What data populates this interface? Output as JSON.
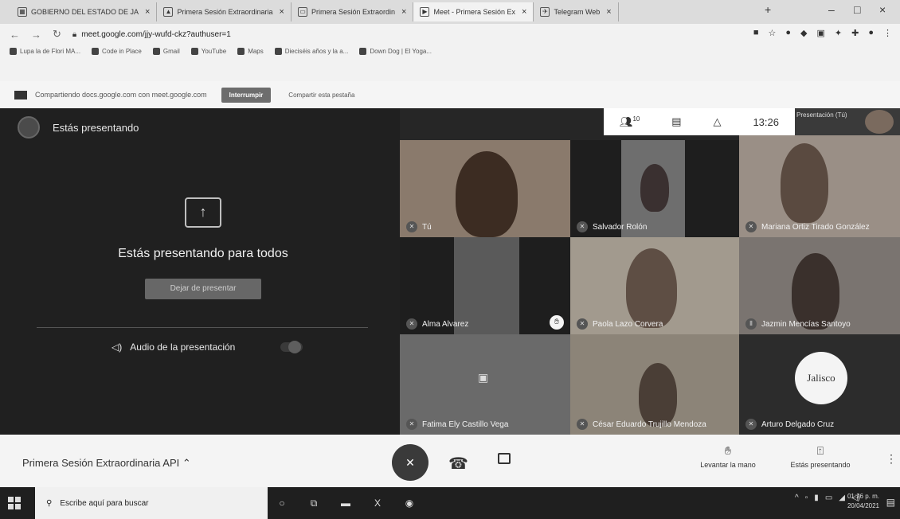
{
  "browser": {
    "tabs": [
      {
        "label": "GOBIERNO DEL ESTADO DE JA",
        "icon": "sheet-icon"
      },
      {
        "label": "Primera Sesión Extraordinaria",
        "icon": "drive-icon"
      },
      {
        "label": "Primera Sesión Extraordin",
        "icon": "slides-icon"
      },
      {
        "label": "Meet - Primera Sesión Ex",
        "icon": "meet-icon"
      },
      {
        "label": "Telegram Web",
        "icon": "telegram-icon"
      }
    ],
    "url": "meet.google.com/jjy-wufd-ckz?authuser=1",
    "bookmarks": [
      "Lupa la de Flori MA...",
      "Code in Place",
      "Gmail",
      "YouTube",
      "Maps",
      "Dieciséis años y la a...",
      "Down Dog | El Yoga..."
    ]
  },
  "share_banner": {
    "text": "Compartiendo docs.google.com con meet.google.com",
    "stop_label": "Interrumpir",
    "share_tab_label": "Compartir esta pestaña"
  },
  "meet": {
    "presenting_title": "Estás presentando",
    "presenting_all": "Estás presentando para todos",
    "stop_presenting": "Dejar de presentar",
    "audio_label": "Audio de la presentación",
    "participant_count": "10",
    "time": "13:26",
    "mini_label": "Presentación (Tú)",
    "participants": [
      {
        "name": "Tú",
        "bg": "#8a7a6c"
      },
      {
        "name": "Salvador Rolón",
        "bg": "#6e6e6e"
      },
      {
        "name": "Mariana Ortiz Tirado González",
        "bg": "#9a8f86"
      },
      {
        "name": "Alma Alvarez",
        "bg": "#5a5a5a"
      },
      {
        "name": "Paola Lazo Corvera",
        "bg": "#a29a8e"
      },
      {
        "name": "Jazmin Mencías Santoyo",
        "bg": "#7a7470"
      },
      {
        "name": "Fatima Ely Castillo Vega",
        "bg": "#6a6a6a"
      },
      {
        "name": "César Eduardo Trujillo Mendoza",
        "bg": "#8c8478"
      },
      {
        "name": "Arturo Delgado Cruz",
        "bg": "#2c2c2c"
      }
    ],
    "jalisco_text": "Jalisco"
  },
  "controls": {
    "meeting_name": "Primera Sesión Extraordinaria API",
    "raise_hand": "Levantar la mano",
    "presenting_btn": "Estás presentando"
  },
  "taskbar": {
    "search_placeholder": "Escribe aquí para buscar",
    "time": "01:26 p. m.",
    "date": "20/04/2021"
  }
}
